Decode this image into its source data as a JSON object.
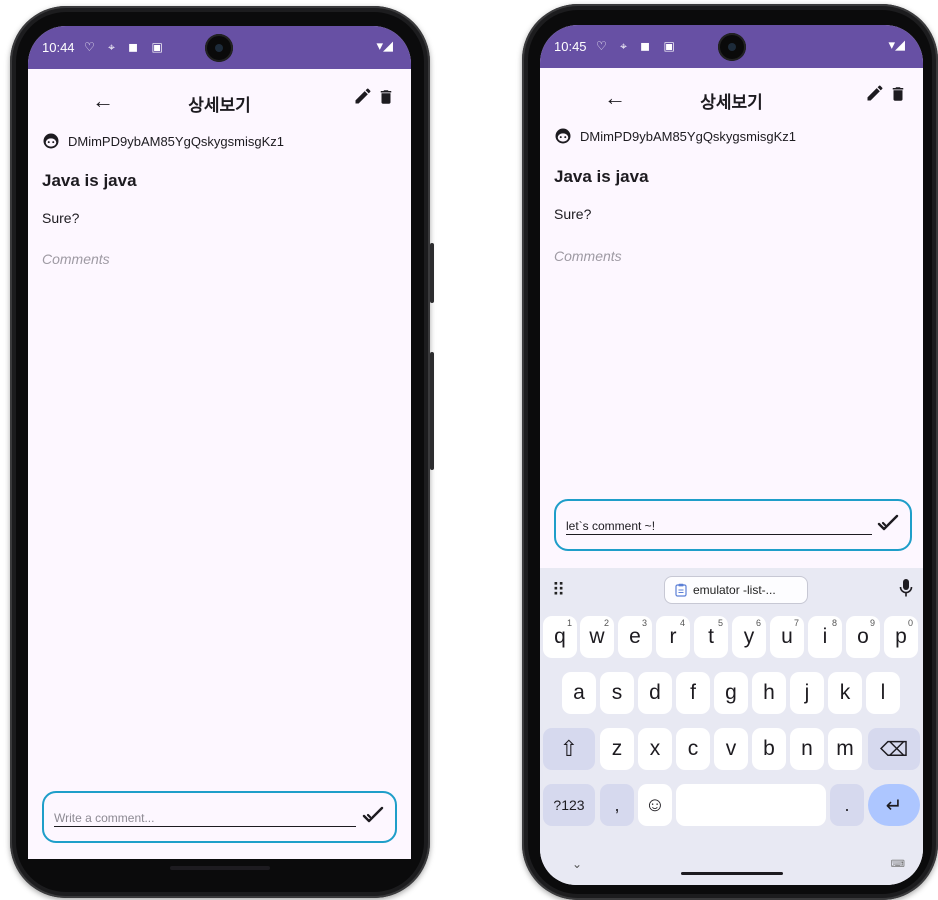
{
  "status_left": {
    "time": "10:44",
    "icons": "♡ ⌖ ◼ ▣"
  },
  "status_right": {
    "time": "10:45",
    "icons": "♡ ⌖ ◼ ▣"
  },
  "status_signal": "▾◢",
  "appbar": {
    "title": "상세보기"
  },
  "post": {
    "author": "DMimPD9ybAM85YgQskygsmisgKz1",
    "title": "Java is java",
    "content": "Sure?"
  },
  "comments_label": "Comments",
  "comment_input": {
    "placeholder": "Write a comment...",
    "value": "let`s comment ~!"
  },
  "keyboard": {
    "clipboard": "emulator -list-...",
    "row1": [
      {
        "k": "q",
        "h": "1"
      },
      {
        "k": "w",
        "h": "2"
      },
      {
        "k": "e",
        "h": "3"
      },
      {
        "k": "r",
        "h": "4"
      },
      {
        "k": "t",
        "h": "5"
      },
      {
        "k": "y",
        "h": "6"
      },
      {
        "k": "u",
        "h": "7"
      },
      {
        "k": "i",
        "h": "8"
      },
      {
        "k": "o",
        "h": "9"
      },
      {
        "k": "p",
        "h": "0"
      }
    ],
    "row2": [
      "a",
      "s",
      "d",
      "f",
      "g",
      "h",
      "j",
      "k",
      "l"
    ],
    "row3": [
      "z",
      "x",
      "c",
      "v",
      "b",
      "n",
      "m"
    ],
    "symbols": "?123",
    "comma": ",",
    "period": ".",
    "emoji": "☺",
    "shift": "⇧",
    "backspace": "⌫",
    "enter": "↵"
  },
  "colors": {
    "statusbar": "#6750a4",
    "focus_border": "#1e9ec9",
    "surface": "#fdf7ff",
    "enter_key": "#adc6ff"
  }
}
